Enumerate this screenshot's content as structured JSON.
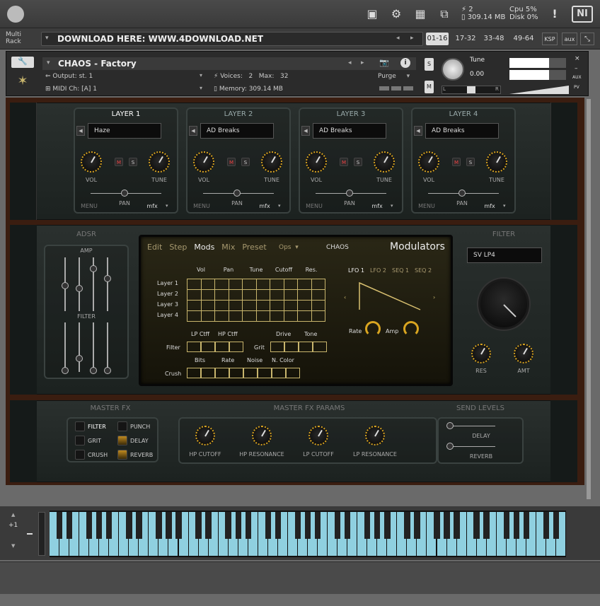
{
  "topbar": {
    "voices": "2",
    "memory": "309.14 MB",
    "cpu_label": "Cpu",
    "cpu": "5%",
    "disk_label": "Disk",
    "disk": "0%",
    "ni_logo": "NI"
  },
  "rack": {
    "label_line1": "Multi",
    "label_line2": "Rack",
    "name": "DOWNLOAD HERE: WWW.4DOWNLOAD.NET",
    "tabs": [
      "01-16",
      "17-32",
      "33-48",
      "49-64",
      "KSP",
      "aux"
    ],
    "active_tab": "01-16"
  },
  "instrument": {
    "name": "CHAOS - Factory",
    "output_label": "Output:",
    "output": "st. 1",
    "midi_label": "MIDI Ch:",
    "midi": "[A]  1",
    "voices_label": "Voices:",
    "voices": "2",
    "max_label": "Max:",
    "max": "32",
    "memory_label": "Memory:",
    "memory": "309.14 MB",
    "purge": "Purge",
    "s": "S",
    "m": "M",
    "tune_label": "Tune",
    "tune_value": "0.00",
    "pan_l": "L",
    "pan_r": "R",
    "aux": "AUX",
    "pv": "PV"
  },
  "layers": [
    {
      "title": "LAYER 1",
      "preset": "Haze"
    },
    {
      "title": "LAYER 2",
      "preset": "AD Breaks"
    },
    {
      "title": "LAYER 3",
      "preset": "AD Breaks"
    },
    {
      "title": "LAYER 4",
      "preset": "AD Breaks"
    }
  ],
  "layer_labels": {
    "vol": "VOL",
    "tune": "TUNE",
    "pan": "PAN",
    "menu": "MENU",
    "mfx": "mfx",
    "m": "M",
    "s": "S"
  },
  "adsr": {
    "title": "ADSR",
    "amp": "AMP",
    "filter": "FILTER"
  },
  "screen": {
    "nav": [
      "Edit",
      "Step",
      "Mods",
      "Mix",
      "Preset"
    ],
    "active": "Mods",
    "ops": "Ops",
    "brand": "CHAOS",
    "title": "Modulators",
    "columns": [
      "Vol",
      "Pan",
      "Tune",
      "Cutoff",
      "Res."
    ],
    "rows": [
      "Layer 1",
      "Layer 2",
      "Layer 3",
      "Layer 4"
    ],
    "lfo_tabs": [
      "LFO 1",
      "LFO 2",
      "SEQ 1",
      "SEQ 2"
    ],
    "active_lfo": "LFO 1",
    "rate": "Rate",
    "amp": "Amp",
    "filter_cols": [
      "LP Ctff",
      "HP Ctff"
    ],
    "filter_label": "Filter",
    "grit_cols": [
      "Drive",
      "Tone"
    ],
    "grit_label": "Grit",
    "crush_cols": [
      "Bits",
      "Rate",
      "Noise",
      "N. Color"
    ],
    "crush_label": "Crush"
  },
  "filter": {
    "title": "FILTER",
    "type": "SV LP4",
    "res": "RES",
    "amt": "AMT"
  },
  "masterfx": {
    "title": "MASTER FX",
    "items": [
      {
        "label": "FILTER",
        "on": false
      },
      {
        "label": "PUNCH",
        "on": false
      },
      {
        "label": "GRIT",
        "on": false
      },
      {
        "label": "DELAY",
        "on": true
      },
      {
        "label": "CRUSH",
        "on": false
      },
      {
        "label": "REVERB",
        "on": true
      }
    ]
  },
  "fxparams": {
    "title": "MASTER FX PARAMS",
    "knobs": [
      "HP CUTOFF",
      "HP RESONANCE",
      "LP CUTOFF",
      "LP RESONANCE"
    ]
  },
  "send": {
    "title": "SEND LEVELS",
    "delay": "DELAY",
    "reverb": "REVERB"
  },
  "keyboard": {
    "octave": "+1"
  },
  "colors": {
    "accent": "#d9a520",
    "keys": "#8fd0e0",
    "panel": "#232a28"
  }
}
